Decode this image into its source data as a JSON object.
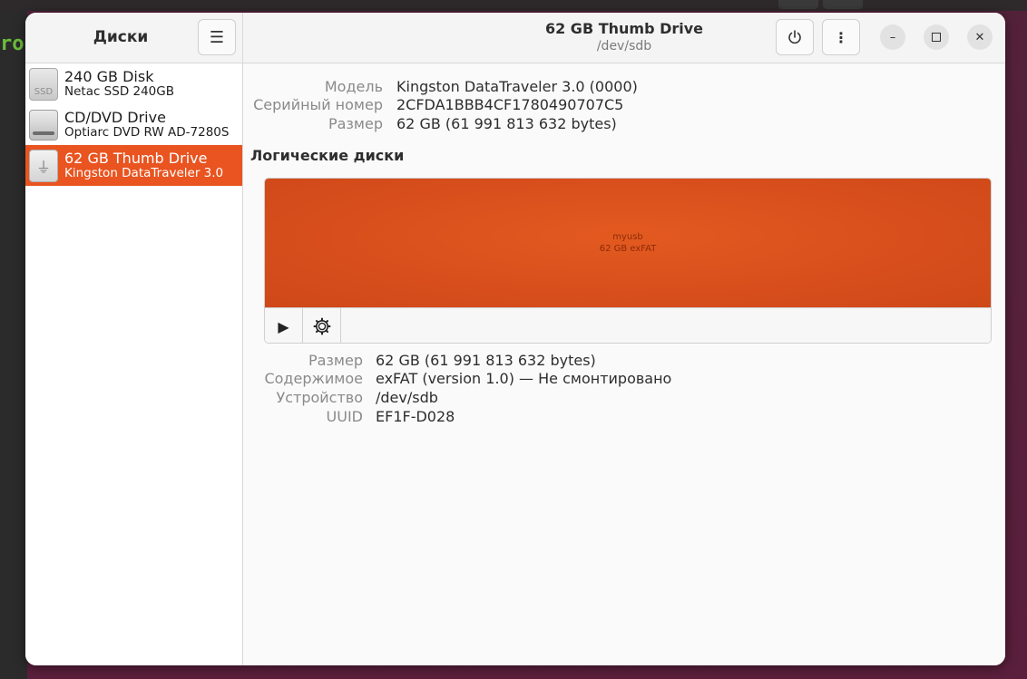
{
  "desktop": {
    "terminal_fragment": "ro"
  },
  "sidebar": {
    "title": "Диски",
    "menu_icon": "hamburger-menu-icon",
    "items": [
      {
        "name": "240 GB Disk",
        "subtitle": "Netac SSD 240GB",
        "icon": "ssd-drive-icon",
        "icon_text": "SSD"
      },
      {
        "name": "CD/DVD Drive",
        "subtitle": "Optiarc DVD RW AD-7280S",
        "icon": "optical-drive-icon"
      },
      {
        "name": "62 GB Thumb Drive",
        "subtitle": "Kingston DataTraveler 3.0",
        "icon": "usb-drive-icon",
        "selected": true
      }
    ]
  },
  "header": {
    "title": "62 GB Thumb Drive",
    "subtitle": "/dev/sdb",
    "power_icon": "power-icon",
    "more_icon": "more-vertical-icon"
  },
  "drive_info": {
    "model_label": "Модель",
    "model_value": "Kingston DataTraveler 3.0 (0000)",
    "serial_label": "Серийный номер",
    "serial_value": "2CFDA1BBB4CF1780490707C5",
    "size_label": "Размер",
    "size_value": "62 GB (61 991 813 632 bytes)"
  },
  "volumes": {
    "section_title": "Логические диски",
    "partition_name": "myusb",
    "partition_desc": "62 GB exFAT",
    "play_icon": "play-mount-icon",
    "settings_icon": "gear-icon"
  },
  "volume_info": {
    "size_label": "Размер",
    "size_value": "62 GB (61 991 813 632 bytes)",
    "content_label": "Содержимое",
    "content_value": "exFAT (version 1.0) — Не смонтировано",
    "device_label": "Устройство",
    "device_value": "/dev/sdb",
    "uuid_label": "UUID",
    "uuid_value": "EF1F-D028"
  },
  "colors": {
    "accent": "#e95420",
    "partition": "#d84f1d"
  }
}
